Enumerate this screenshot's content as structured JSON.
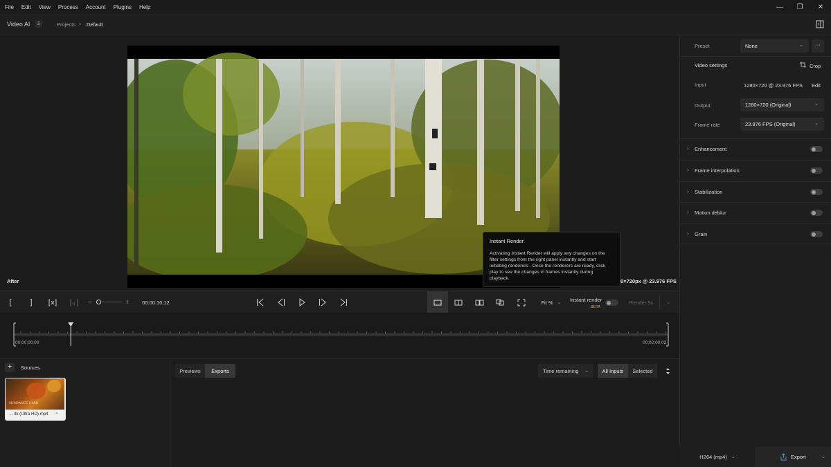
{
  "menu": [
    "File",
    "Edit",
    "View",
    "Process",
    "Account",
    "Plugins",
    "Help"
  ],
  "window_controls": {
    "minimize": "—",
    "restore": "❐",
    "close": "✕"
  },
  "header": {
    "app_name": "Video AI",
    "version_badge": "5",
    "breadcrumb_root": "Projects",
    "breadcrumb_current": "Default"
  },
  "preview": {
    "view_label": "After",
    "resolution_readout": "0×720px @ 23.976 FPS"
  },
  "tooltip": {
    "title": "Instant Render",
    "body": "Activating Instant Render will apply any changes on the filter settings from the right panel instantly and start initiating renderers . Once the renderers are ready, click play to see the changes in frames instantly during playback."
  },
  "controls": {
    "mark_in": "[",
    "mark_out": "]",
    "timecode": "00:00:10;12",
    "zoom_minus": "−",
    "zoom_plus": "+",
    "zoom_level": 0.0,
    "fit_label": "Fit %",
    "instant_render_label": "Instant render",
    "beta_label": "BETA",
    "render_button": "Render 5s"
  },
  "timeline": {
    "start_time": "00;00;00;00",
    "end_time": "00;02;00;02",
    "playhead_fraction": 0.087
  },
  "sources": {
    "title": "Sources",
    "add_icon": "+",
    "items": [
      {
        "name": "... 4k (Ultra HD).mp4",
        "overlay_text": "SUNDANCE UTAH",
        "more": "···"
      }
    ]
  },
  "queue": {
    "tabs": [
      "Previews",
      "Exports"
    ],
    "active_tab": "Exports",
    "sort_select": "Time remaining",
    "filters": [
      "All Inputs",
      "Selected"
    ],
    "active_filter": "All Inputs"
  },
  "right_panel": {
    "preset_label": "Preset",
    "preset_value": "None",
    "preset_more": "···",
    "video_settings_title": "Video settings",
    "crop_label": "Crop",
    "input_label": "Input",
    "input_value": "1280×720 @ 23.976 FPS",
    "edit_label": "Edit",
    "output_label": "Output",
    "output_value": "1280×720 (Original)",
    "frame_rate_label": "Frame rate",
    "frame_rate_value": "23.976 FPS (Original)",
    "filters": [
      {
        "label": "Enhancement",
        "enabled": false
      },
      {
        "label": "Frame interpolation",
        "enabled": false
      },
      {
        "label": "Stabilization",
        "enabled": false
      },
      {
        "label": "Motion deblur",
        "enabled": false
      },
      {
        "label": "Grain",
        "enabled": false
      }
    ],
    "codec": "H264 (mp4)",
    "export_label": "Export"
  },
  "colors": {
    "accent_blue": "#4a9ad8",
    "beta_yellow": "#c9b24a",
    "panel_bg": "#1e1e1e"
  }
}
